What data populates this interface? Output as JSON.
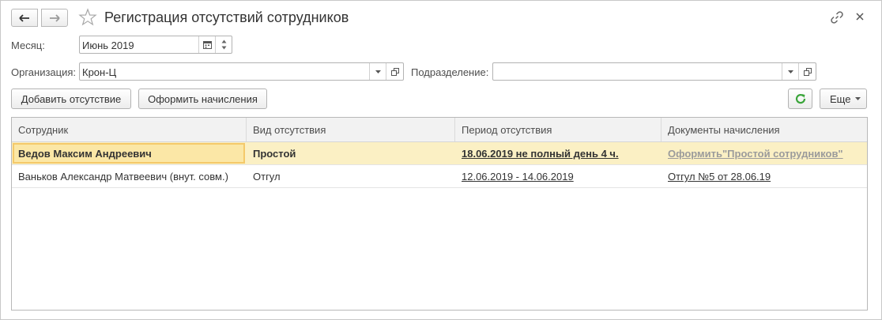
{
  "window": {
    "title": "Регистрация отсутствий сотрудников"
  },
  "filters": {
    "month_label": "Месяц:",
    "month_value": "Июнь 2019",
    "org_label": "Организация:",
    "org_value": "Крон-Ц",
    "dept_label": "Подразделение:",
    "dept_value": ""
  },
  "toolbar": {
    "add_absence": "Добавить отсутствие",
    "make_accruals": "Оформить начисления",
    "more": "Еще"
  },
  "table": {
    "columns": [
      "Сотрудник",
      "Вид отсутствия",
      "Период отсутствия",
      "Документы начисления"
    ],
    "rows": [
      {
        "employee": "Ведов Максим Андреевич",
        "absence_type": "Простой",
        "period": "18.06.2019 не полный день 4 ч.",
        "document": "Оформить\"Простой сотрудников\""
      },
      {
        "employee": "Ваньков Александр Матвеевич (внут. совм.)",
        "absence_type": "Отгул",
        "period": "12.06.2019 - 14.06.2019",
        "document": "Отгул №5 от 28.06.19"
      }
    ]
  },
  "colors": {
    "selected_row": "#fbf0c4",
    "refresh_green": "#3aa53a"
  }
}
